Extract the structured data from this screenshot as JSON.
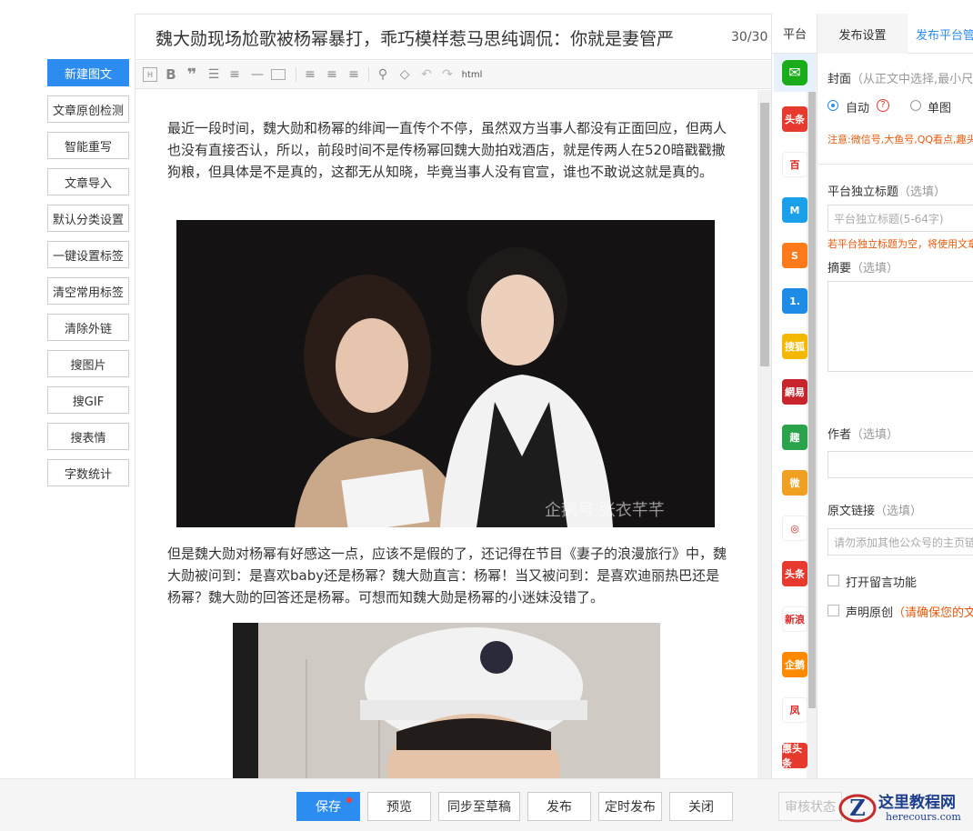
{
  "sidebar": {
    "buttons": [
      "新建图文",
      "文章原创检测",
      "智能重写",
      "文章导入",
      "默认分类设置",
      "一键设置标签",
      "清空常用标签",
      "清除外链",
      "搜图片",
      "搜GIF",
      "搜表情",
      "字数统计"
    ]
  },
  "editor": {
    "title": "魏大勋现场尬歌被杨幂暴打，乖巧模样惹马思纯调侃：你就是妻管严",
    "title_count": "30/30",
    "toolbar": {
      "html_label": "html"
    },
    "paragraphs": [
      "最近一段时间，魏大勋和杨幂的绯闻一直传个不停，虽然双方当事人都没有正面回应，但两人也没有直接否认，所以，前段时间不是传杨幂回魏大勋拍戏酒店，就是传两人在520暗戳戳撒狗粮，但具体是不是真的，这都无从知晓，毕竟当事人没有官宣，谁也不敢说这就是真的。",
      "但是魏大勋对杨幂有好感这一点，应该不是假的了，还记得在节目《妻子的浪漫旅行》中，魏大勋被问到：是喜欢baby还是杨幂？魏大勋直言：杨幂！当又被问到：是喜欢迪丽热巴还是杨幂？魏大勋的回答还是杨幂。可想而知魏大勋是杨幂的小迷妹没错了。"
    ],
    "image1_watermark": "企鹅号 张衣芊芊"
  },
  "platforms": {
    "header": "平台",
    "items": [
      {
        "name": "wechat",
        "label": "",
        "color": "#1aad19"
      },
      {
        "name": "toutiao",
        "label": "头条",
        "color": "#e8392e"
      },
      {
        "name": "baidu",
        "label": "百",
        "color": "#ffffff"
      },
      {
        "name": "mp",
        "label": "M",
        "color": "#1aa0e8"
      },
      {
        "name": "dayu",
        "label": "S",
        "color": "#ff7a1a"
      },
      {
        "name": "yidian",
        "label": "1.",
        "color": "#1e8be6"
      },
      {
        "name": "sohu",
        "label": "搜狐",
        "color": "#f5b800"
      },
      {
        "name": "netease",
        "label": "網易",
        "color": "#c8242c"
      },
      {
        "name": "qutoutiao",
        "label": "趣",
        "color": "#2aa34a"
      },
      {
        "name": "weibo",
        "label": "微",
        "color": "#f0a020"
      },
      {
        "name": "diandian",
        "label": "◎",
        "color": "#ffffff"
      },
      {
        "name": "toutiao2",
        "label": "头条",
        "color": "#e8392e"
      },
      {
        "name": "xinlang",
        "label": "新浪",
        "color": "#ffffff"
      },
      {
        "name": "qiehao",
        "label": "企鹅",
        "color": "#ff8a00"
      },
      {
        "name": "fenghuang",
        "label": "凤",
        "color": "#ffffff"
      },
      {
        "name": "huitoutiao",
        "label": "惠头条",
        "color": "#e8392e"
      }
    ]
  },
  "settings": {
    "tab_publish": "发布设置",
    "tab_platform": "发布平台管理",
    "cover_label": "封面",
    "cover_hint": "（从正文中选择,最小尺寸",
    "cover_auto": "自动",
    "cover_single": "单图",
    "cover_note": "注意:微信号,大鱼号,QQ看点,趣头条",
    "title_label": "平台独立标题",
    "optional": "（选填）",
    "title_placeholder": "平台独立标题(5-64字)",
    "title_note": "若平台独立标题为空，将使用文章标题",
    "summary_label": "摘要",
    "author_label": "作者",
    "link_label": "原文链接",
    "link_placeholder": "请勿添加其他公众号的主页链接",
    "comment_label": "打开留言功能",
    "original_label": "声明原创",
    "original_note": "（请确保您的文章为原创"
  },
  "bottom": {
    "save": "保存",
    "preview": "预览",
    "sync_draft": "同步至草稿",
    "publish": "发布",
    "schedule": "定时发布",
    "close": "关闭",
    "review_status": "审核状态"
  },
  "watermark": {
    "title": "这里教程网",
    "url": "herecours.com"
  }
}
